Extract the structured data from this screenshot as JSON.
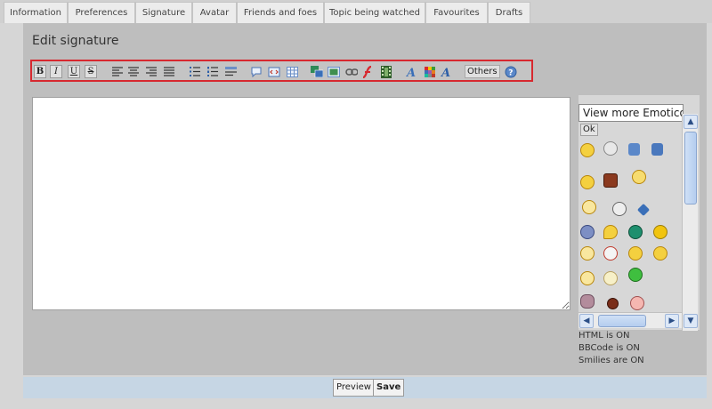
{
  "tabs": [
    {
      "label": "Information"
    },
    {
      "label": "Preferences"
    },
    {
      "label": "Signature"
    },
    {
      "label": "Avatar"
    },
    {
      "label": "Friends and foes"
    },
    {
      "label": "Topic being watched"
    },
    {
      "label": "Favourites"
    },
    {
      "label": "Drafts"
    }
  ],
  "page": {
    "title": "Edit signature"
  },
  "toolbar": {
    "bold": "B",
    "italic": "I",
    "underline": "U",
    "strike": "S",
    "others_label": "Others",
    "accent": "#d7282f"
  },
  "emoticons": {
    "select_value": "View more Emoticons",
    "ok_label": "Ok"
  },
  "status": {
    "html": "HTML is ON",
    "bbcode": "BBCode is ON",
    "smilies": "Smilies are ON"
  },
  "footer": {
    "preview_label": "Preview",
    "save_label": "Save"
  }
}
